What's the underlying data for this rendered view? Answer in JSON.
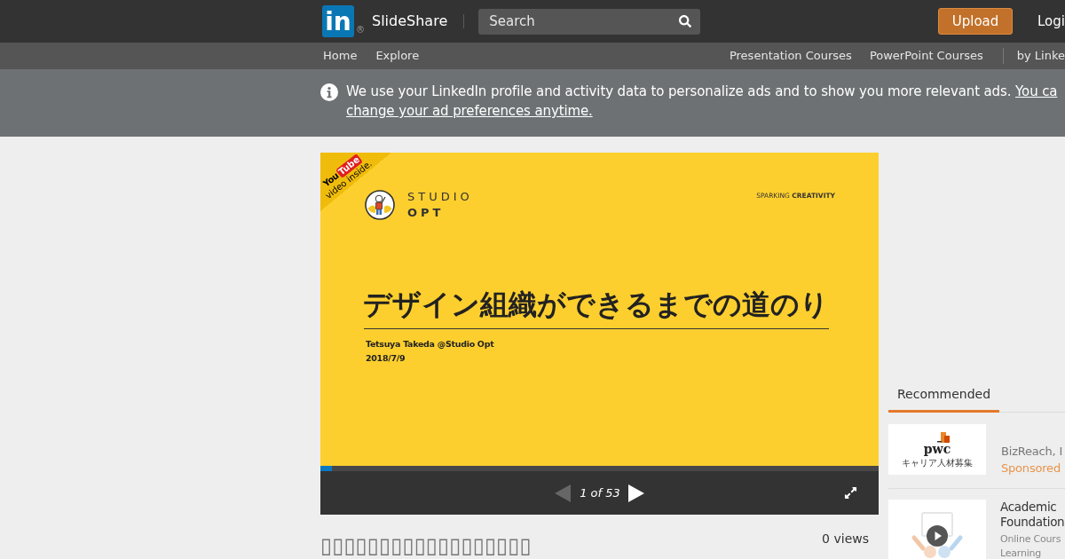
{
  "header": {
    "logo": {
      "text": "in",
      "mark": "®"
    },
    "brand": "SlideShare",
    "search": {
      "placeholder": "Search"
    },
    "upload_button": "Upload",
    "login_link": "Logi"
  },
  "subnav": {
    "left_links": [
      "Home",
      "Explore"
    ],
    "right_links": [
      "Presentation Courses",
      "PowerPoint Courses"
    ],
    "partner_link": "by Linke"
  },
  "notice": {
    "text": "We use your LinkedIn profile and activity data to personalize ads and to show you more relevant ads.",
    "link_lines": [
      "You ca",
      "change your ad preferences anytime."
    ]
  },
  "slide": {
    "ribbon": {
      "logo_you": "You",
      "logo_tube": "Tube",
      "caption": "video inside."
    },
    "studio_name": "STUDIO",
    "studio_sub": "OPT",
    "tagline": "SPARKING **CREATIVITY**",
    "title": "デザイン組織ができるまでの道のり",
    "author": "Tetsuya Takeda @Studio Opt",
    "date": "2018/7/9"
  },
  "player": {
    "progress": {
      "level": 0.02
    },
    "prev_button": {
      "disabled": true
    },
    "next_button": {
      "disabled": false
    },
    "page_label": "1 of 53"
  },
  "presentation": {
    "title": "▯▯▯▯▯▯▯▯▯▯▯▯▯▯▯▯▯▯",
    "views": "0 views"
  },
  "sidebar": {
    "tabs": [
      {
        "label": "Recommended",
        "selected": true
      }
    ],
    "items": [
      {
        "kind": "ad",
        "thumbnail": {
          "logo": "pwc",
          "caption": "キャリア人材募集"
        },
        "lines": [
          "BizReach, I"
        ],
        "sponsor_label": "Sponsored"
      },
      {
        "kind": "course",
        "title_lines": [
          "Academic",
          "Foundation"
        ],
        "meta_lines": [
          "Online Cours",
          "Learning"
        ]
      }
    ]
  }
}
